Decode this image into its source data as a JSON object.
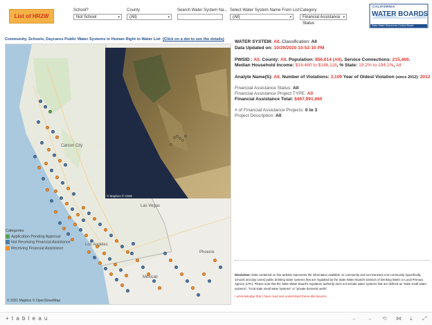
{
  "header": {
    "list_button": "List of HR2W",
    "filters": [
      {
        "label": "School?",
        "value": "Not School"
      },
      {
        "label": "County",
        "value": "(All)"
      },
      {
        "label": "Search Water System Na...",
        "value": ""
      },
      {
        "label": "Select Water System Name From List",
        "value": "(All)"
      },
      {
        "label": "Category",
        "value": "Financial Assistance Status"
      }
    ],
    "logo": {
      "top": "CALIFORNIA",
      "main": "WATER BOARDS",
      "sub": "State Water Resources Control Board"
    }
  },
  "map": {
    "title": "Community, Schools, Daycares Public Water Systems in Human Right to Water List",
    "title_link": "(Click on a dot to see the details)",
    "attribution": "© 2021 Mapbox  © OpenStreetMap",
    "inset_attribution": "© Mapbox  © OSM",
    "city_labels": [
      "Carson City",
      "Las Vegas",
      "Los Angeles",
      "Mexicali",
      "Phoenix"
    ],
    "legend": {
      "title": "Categories",
      "items": [
        {
          "label": "Application Pending Approval",
          "color": "#59a14f"
        },
        {
          "label": "Not Receiving Financial Assistance",
          "color": "#4e79a7"
        },
        {
          "label": "Receiving Financial Assistance",
          "color": "#f28e2b"
        }
      ]
    }
  },
  "details": {
    "water_system_label": "WATER SYSTEM:",
    "water_system_value": "All",
    "classification_label": "Classification:",
    "classification_value": "All",
    "data_updated_label": "Data Updated on:",
    "data_updated_value": "10/29/2020 10:52:10 PM",
    "pwsid_label": "PWSID :",
    "pwsid_value": "All",
    "county_label": "County:",
    "county_value": "All",
    "population_label": "Population:",
    "population_value": "856,614",
    "population_extra": "(All)",
    "service_connections_label": "Service Connections:",
    "service_connections_value": "215,469",
    "income_label": "Median Household Income:",
    "income_value": "$14,460 to $146,118",
    "state_label": "% State:",
    "state_value": "19.2% to 194.1%",
    "state_extra": "All",
    "analyte_label": "Analyte Name(S):",
    "analyte_value": "All",
    "violations_label": "Number of Violations:",
    "violations_value": "3,109",
    "oldest_label": "Year of Oldest Violation",
    "oldest_qualifier": "(since 2012):",
    "oldest_value": "2012",
    "fa_status_label": "Financial Assistance Status:",
    "fa_status_value": "All",
    "fa_project_type_label": "Financial Assistance Project TYPE:",
    "fa_project_type_value": "All",
    "fa_total_label": "Financial Assistance Total:",
    "fa_total_value": "$467,991,660",
    "fa_projects_label": "# of Financial Assistance Projects:",
    "fa_projects_value": "0 to 3",
    "project_desc_label": "Project Description:",
    "project_desc_value": "All"
  },
  "disclaimer": {
    "label": "Disclaimer:",
    "text": "Data contained on this website represents the information available on community and non-transient non-community (specifically schools and day cares) public drinking water systems that are regulated by the State Water Board's Division of Drinking Water or Local Primacy Agency (LPA). Please note that the State Water Board's regulatory authority does not include water systems that are defined as \"state small water systems\", \"local state small water systems\" or \"private domestic wells\".",
    "acknowledge": "I acknowledge that I have read and understand these disclosures."
  },
  "footer": {
    "brand": "+ t a b l e a u"
  },
  "colors": {
    "accent_red": "#e0322a",
    "green": "#3b9a3b",
    "button_bg": "#f4b247",
    "button_text": "#d4301c",
    "logo_blue": "#1f4e8c"
  }
}
